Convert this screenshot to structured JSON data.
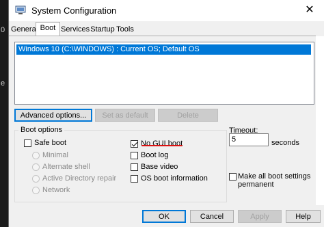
{
  "left_strip": {
    "glyph_a": "0",
    "glyph_b": "e"
  },
  "window": {
    "title": "System Configuration",
    "close_glyph": "✕"
  },
  "tabs": [
    {
      "label": "General"
    },
    {
      "label": "Boot",
      "active": true
    },
    {
      "label": "Services"
    },
    {
      "label": "Startup"
    },
    {
      "label": "Tools"
    }
  ],
  "os_list": {
    "items": [
      "Windows 10 (C:\\WINDOWS) : Current OS; Default OS"
    ],
    "selected_index": 0
  },
  "action_buttons": {
    "advanced": "Advanced options...",
    "set_default": "Set as default",
    "delete": "Delete"
  },
  "boot_options": {
    "legend": "Boot options",
    "safe_boot": {
      "label": "Safe boot",
      "checked": false
    },
    "safe_sub": [
      "Minimal",
      "Alternate shell",
      "Active Directory repair",
      "Network"
    ],
    "no_gui_boot": {
      "label": "No GUI boot",
      "checked": true
    },
    "boot_log": {
      "label": "Boot log",
      "checked": false
    },
    "base_video": {
      "label": "Base video",
      "checked": false
    },
    "os_boot_info": {
      "label": "OS boot information",
      "checked": false
    }
  },
  "timeout": {
    "label": "Timeout:",
    "value": "5",
    "unit": "seconds"
  },
  "permanent": {
    "line1": "Make all boot settings",
    "line2": "permanent",
    "checked": false
  },
  "footer": {
    "ok": "OK",
    "cancel": "Cancel",
    "apply": "Apply",
    "help": "Help"
  },
  "colors": {
    "selection": "#0078d7",
    "annotation_red": "#dd1111"
  }
}
